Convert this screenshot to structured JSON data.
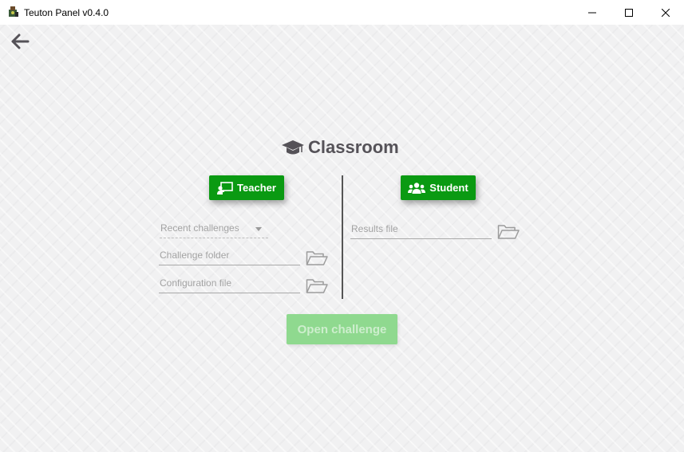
{
  "window": {
    "title": "Teuton Panel v0.4.0",
    "minimize_icon": "minimize-icon",
    "maximize_icon": "maximize-icon",
    "close_icon": "close-icon"
  },
  "nav": {
    "back_icon": "arrow-left-icon"
  },
  "heading": {
    "icon": "graduation-cap-icon",
    "text": "Classroom"
  },
  "teacher": {
    "button_label": "Teacher",
    "button_icon": "chalkboard-teacher-icon",
    "recent_challenges": {
      "placeholder": "Recent challenges"
    },
    "challenge_folder": {
      "placeholder": "Challenge folder",
      "browse_icon": "folder-open-icon"
    },
    "configuration_file": {
      "placeholder": "Configuration file",
      "browse_icon": "folder-open-icon"
    }
  },
  "student": {
    "button_label": "Student",
    "button_icon": "users-icon",
    "results_file": {
      "placeholder": "Results file",
      "browse_icon": "folder-open-icon"
    }
  },
  "actions": {
    "open_challenge_label": "Open challenge",
    "open_challenge_enabled": false
  },
  "colors": {
    "accent_green": "#0a9a12",
    "disabled_green": "#8fd98f",
    "heading_text": "#555258",
    "field_text": "#a3a3a3"
  }
}
